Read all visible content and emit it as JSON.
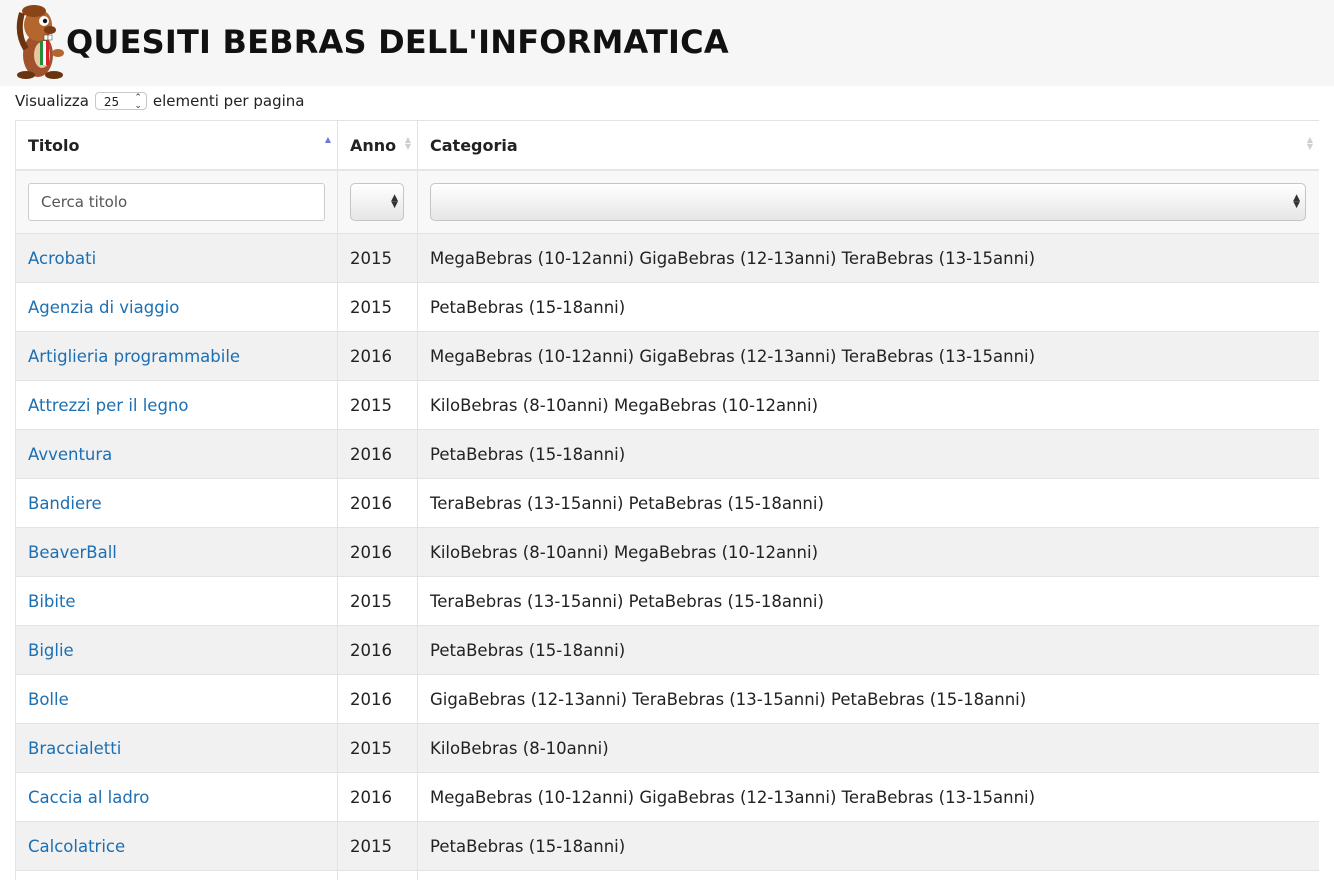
{
  "header": {
    "title": "QUESITI BEBRAS DELL'INFORMATICA"
  },
  "length_menu": {
    "prefix": "Visualizza",
    "value": "25",
    "suffix": "elementi per pagina"
  },
  "table": {
    "columns": [
      {
        "label": "Titolo",
        "sorted": "asc"
      },
      {
        "label": "Anno",
        "sorted": "none"
      },
      {
        "label": "Categoria",
        "sorted": "none"
      }
    ],
    "filters": {
      "title_placeholder": "Cerca titolo",
      "year_value": "",
      "category_value": ""
    },
    "rows": [
      {
        "title": "Acrobati",
        "year": "2015",
        "category": "MegaBebras (10-12anni) GigaBebras (12-13anni) TeraBebras (13-15anni)"
      },
      {
        "title": "Agenzia di viaggio",
        "year": "2015",
        "category": "PetaBebras (15-18anni)"
      },
      {
        "title": "Artiglieria programmabile",
        "year": "2016",
        "category": "MegaBebras (10-12anni) GigaBebras (12-13anni) TeraBebras (13-15anni)"
      },
      {
        "title": "Attrezzi per il legno",
        "year": "2015",
        "category": "KiloBebras (8-10anni) MegaBebras (10-12anni)"
      },
      {
        "title": "Avventura",
        "year": "2016",
        "category": "PetaBebras (15-18anni)"
      },
      {
        "title": "Bandiere",
        "year": "2016",
        "category": "TeraBebras (13-15anni) PetaBebras (15-18anni)"
      },
      {
        "title": "BeaverBall",
        "year": "2016",
        "category": "KiloBebras (8-10anni) MegaBebras (10-12anni)"
      },
      {
        "title": "Bibite",
        "year": "2015",
        "category": "TeraBebras (13-15anni) PetaBebras (15-18anni)"
      },
      {
        "title": "Biglie",
        "year": "2016",
        "category": "PetaBebras (15-18anni)"
      },
      {
        "title": "Bolle",
        "year": "2016",
        "category": "GigaBebras (12-13anni) TeraBebras (13-15anni) PetaBebras (15-18anni)"
      },
      {
        "title": "Braccialetti",
        "year": "2015",
        "category": "KiloBebras (8-10anni)"
      },
      {
        "title": "Caccia al ladro",
        "year": "2016",
        "category": "MegaBebras (10-12anni) GigaBebras (12-13anni) TeraBebras (13-15anni)"
      },
      {
        "title": "Calcolatrice",
        "year": "2015",
        "category": "PetaBebras (15-18anni)"
      },
      {
        "title": "",
        "year": "",
        "category": ""
      }
    ]
  },
  "colors": {
    "link": "#1c6fb3",
    "sort_active": "#6a7bd0",
    "header_bg": "#f6f6f6",
    "row_stripe": "#f1f1f1"
  }
}
